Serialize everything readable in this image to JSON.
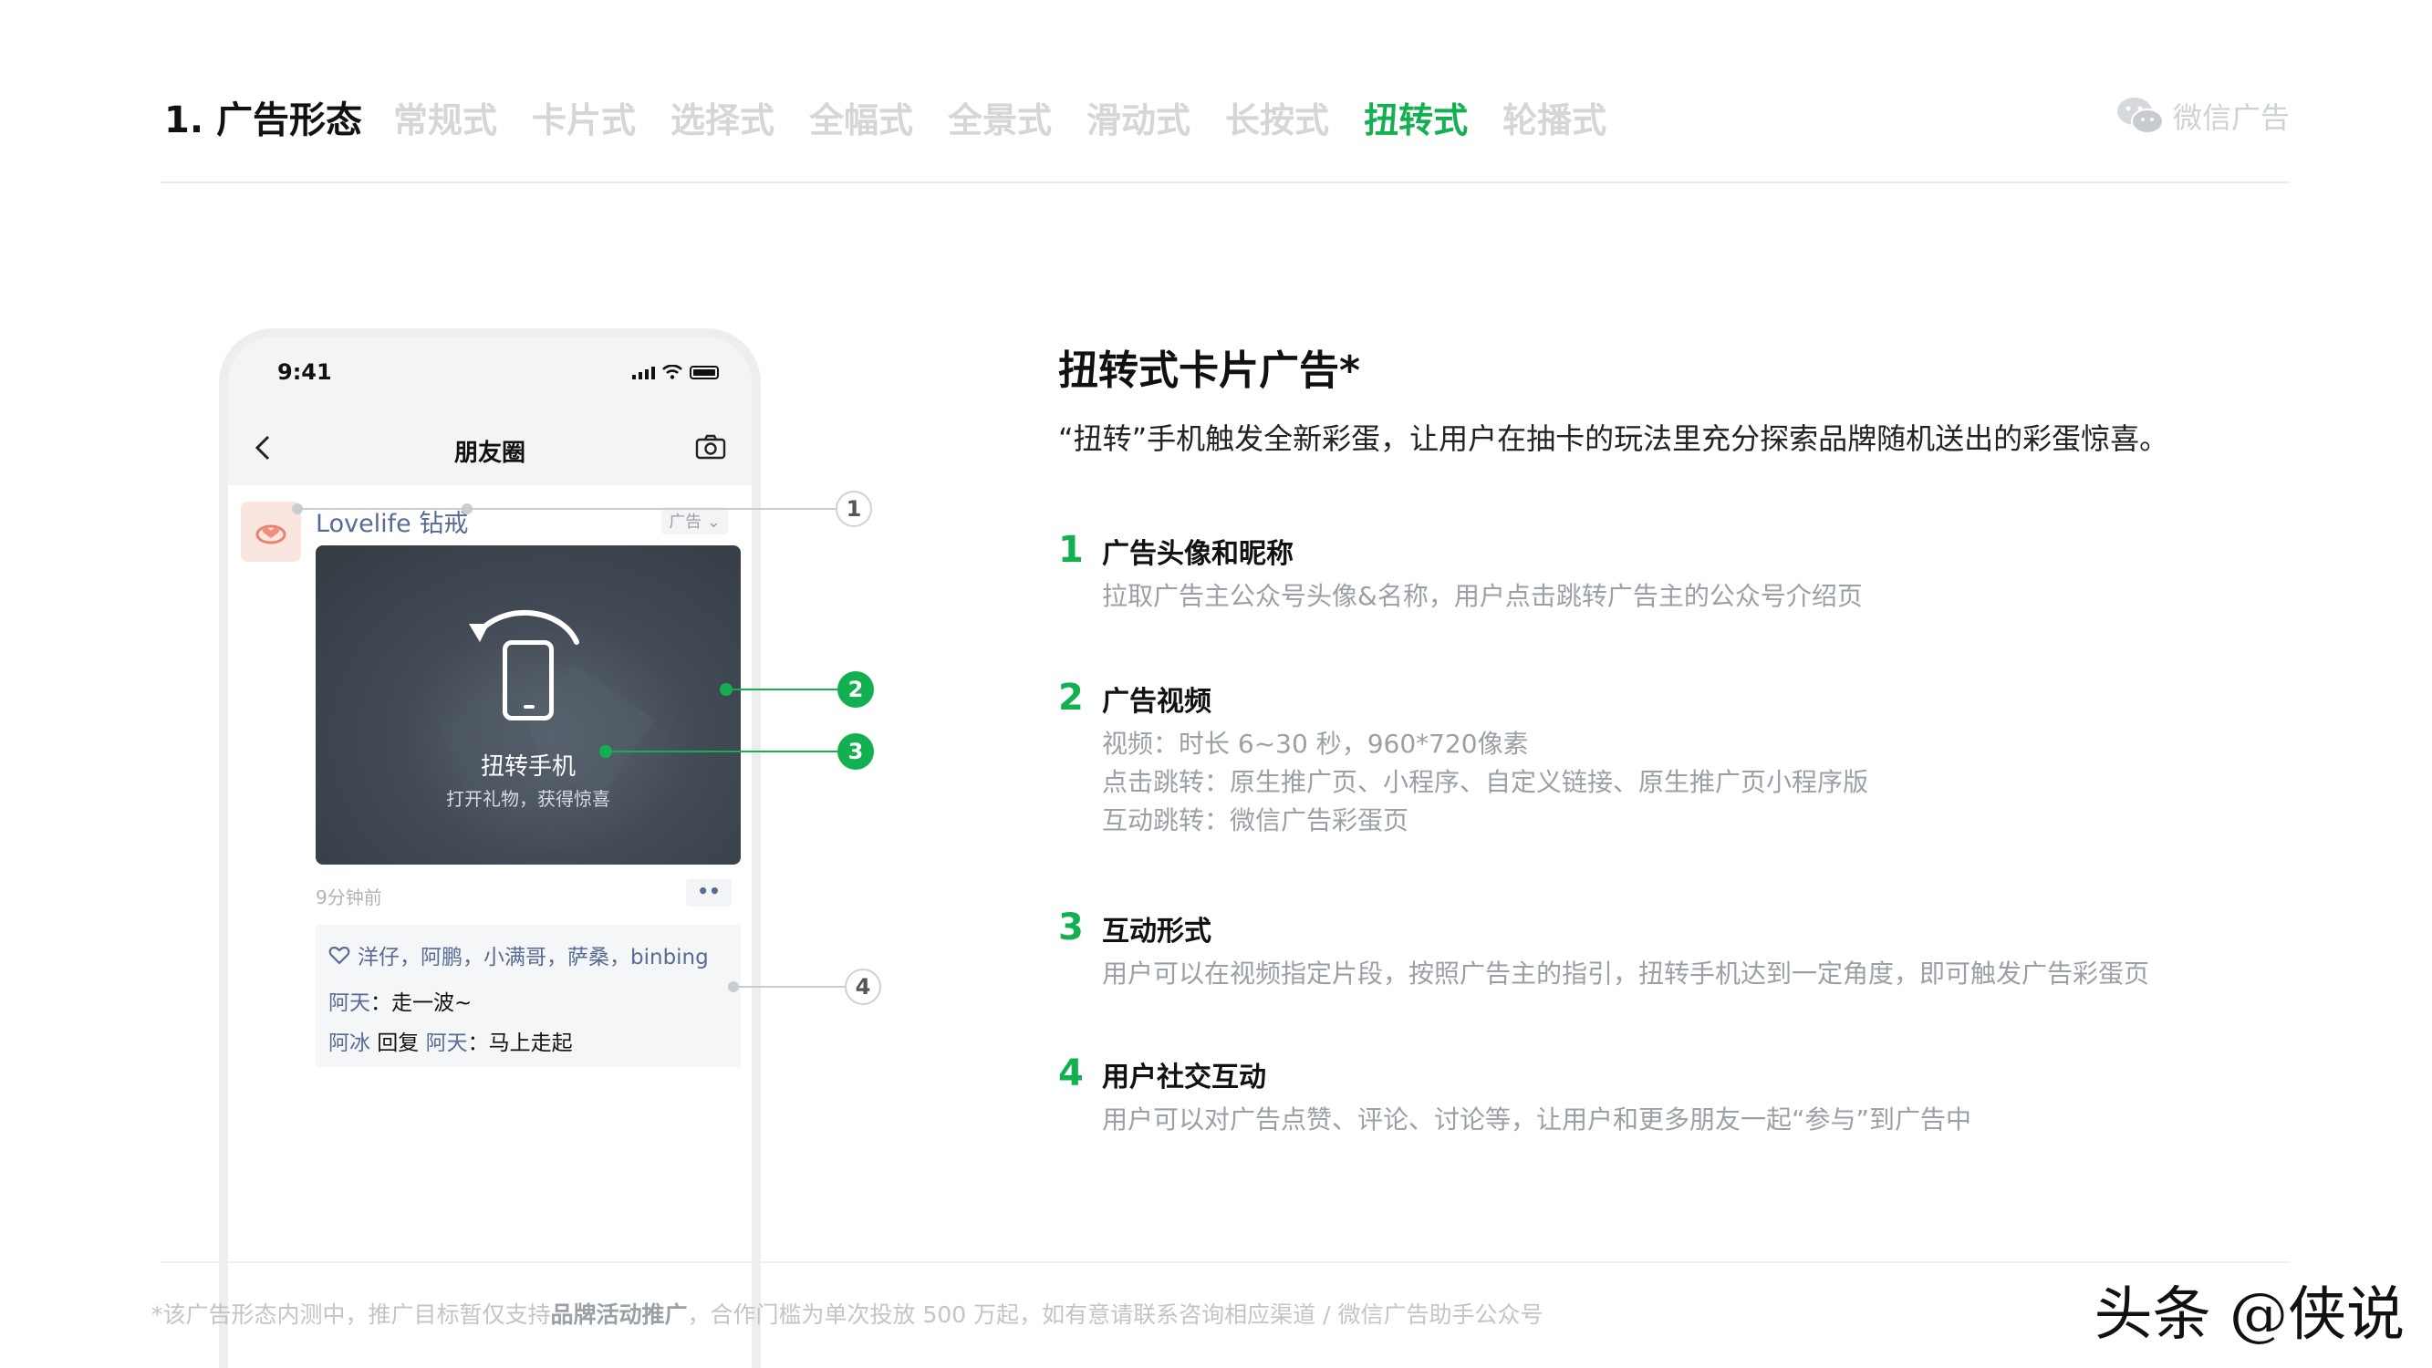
{
  "header": {
    "section_title": "1. 广告形态",
    "tabs": [
      {
        "label": "常规式",
        "active": false
      },
      {
        "label": "卡片式",
        "active": false
      },
      {
        "label": "选择式",
        "active": false
      },
      {
        "label": "全幅式",
        "active": false
      },
      {
        "label": "全景式",
        "active": false
      },
      {
        "label": "滑动式",
        "active": false
      },
      {
        "label": "长按式",
        "active": false
      },
      {
        "label": "扭转式",
        "active": true
      },
      {
        "label": "轮播式",
        "active": false
      }
    ],
    "brand": "微信广告"
  },
  "colors": {
    "accent_green": "#12b050",
    "inactive_tab": "#d4d6d8",
    "link_blue": "#576b95"
  },
  "phone": {
    "status_time": "9:41",
    "nav_title": "朋友圈",
    "back_icon": "chevron-left-icon",
    "camera_icon": "camera-icon",
    "ad": {
      "nickname": "Lovelife 钻戒",
      "ad_tag": "广告 ⌄",
      "video_label": "扭转手机",
      "video_sublabel": "打开礼物，获得惊喜",
      "time_ago": "9分钟前",
      "more_button": "••",
      "likes": "洋仔，阿鹏，小满哥，萨桑，binbing",
      "comments": [
        {
          "user": "阿天",
          "sep": "：",
          "text": "走一波~"
        },
        {
          "user": "阿冰",
          "mid": " 回复 ",
          "reply_to": "阿天",
          "sep": "：",
          "text": "马上走起"
        }
      ]
    }
  },
  "callouts": [
    "1",
    "2",
    "3",
    "4"
  ],
  "info": {
    "heading": "扭转式卡片广告*",
    "description": "“扭转”手机触发全新彩蛋，让用户在抽卡的玩法里充分探索品牌随机送出的彩蛋惊喜。",
    "features": [
      {
        "num": "1",
        "title": "广告头像和昵称",
        "lines": [
          "拉取广告主公众号头像&名称，用户点击跳转广告主的公众号介绍页"
        ]
      },
      {
        "num": "2",
        "title": "广告视频",
        "lines": [
          "视频：时长 6~30 秒，960*720像素",
          "点击跳转：原生推广页、小程序、自定义链接、原生推广页小程序版",
          "互动跳转：微信广告彩蛋页"
        ]
      },
      {
        "num": "3",
        "title": "互动形式",
        "lines": [
          "用户可以在视频指定片段，按照广告主的指引，扭转手机达到一定角度，即可触发广告彩蛋页"
        ]
      },
      {
        "num": "4",
        "title": "用户社交互动",
        "lines": [
          "用户可以对广告点赞、评论、讨论等，让用户和更多朋友一起“参与”到广告中"
        ]
      }
    ]
  },
  "footer": {
    "note_prefix": "*该广告形态内测中，推广目标暂仅支持",
    "note_bold": "品牌活动推广",
    "note_suffix": "，合作门槛为单次投放 500 万起，如有意请联系咨询相应渠道 / 微信广告助手公众号",
    "watermark": "头条 @侠说"
  }
}
